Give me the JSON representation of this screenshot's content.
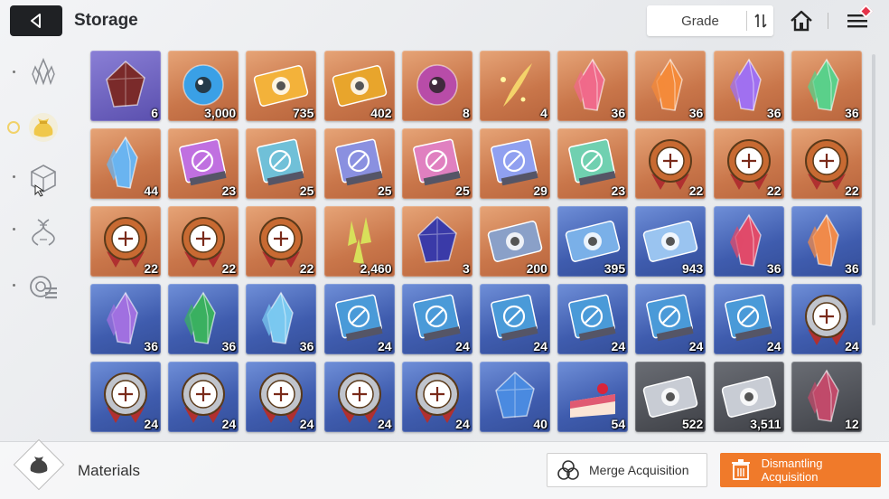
{
  "header": {
    "title": "Storage",
    "sort_label": "Grade"
  },
  "sidebar": {
    "categories": [
      {
        "icon": "crystal-cluster-icon",
        "active": false
      },
      {
        "icon": "pouch-icon",
        "active": true
      },
      {
        "icon": "cube-icon",
        "active": false
      },
      {
        "icon": "dna-helix-icon",
        "active": false
      },
      {
        "icon": "gear-list-icon",
        "active": false
      }
    ]
  },
  "items": [
    {
      "icon": "dark-stone-icon",
      "qty": "6",
      "rarity": "purple",
      "tint": "#7a2a2a"
    },
    {
      "icon": "blue-orb-creature-icon",
      "qty": "3,000",
      "rarity": "orange",
      "tint": "#3aa0e6"
    },
    {
      "icon": "gold-ticket-icon",
      "qty": "735",
      "rarity": "orange",
      "tint": "#f3b23a"
    },
    {
      "icon": "gold-compass-ticket-icon",
      "qty": "402",
      "rarity": "orange",
      "tint": "#e8a52c"
    },
    {
      "icon": "purple-eye-icon",
      "qty": "8",
      "rarity": "orange",
      "tint": "#b84ca8"
    },
    {
      "icon": "gold-feather-icon",
      "qty": "4",
      "rarity": "orange",
      "tint": "#f4d36a"
    },
    {
      "icon": "pink-crystal-icon",
      "qty": "36",
      "rarity": "orange",
      "tint": "#f06a8a"
    },
    {
      "icon": "orange-crystal-icon",
      "qty": "36",
      "rarity": "orange",
      "tint": "#f48a3a"
    },
    {
      "icon": "violet-crystal-icon",
      "qty": "36",
      "rarity": "orange",
      "tint": "#a070f0"
    },
    {
      "icon": "green-crystal-icon",
      "qty": "36",
      "rarity": "orange",
      "tint": "#5ad08a"
    },
    {
      "icon": "blue-crystal-icon",
      "qty": "44",
      "rarity": "orange",
      "tint": "#6ab4f0"
    },
    {
      "icon": "rainbow-book-sword-icon",
      "qty": "23",
      "rarity": "orange",
      "tint": "#c070e0"
    },
    {
      "icon": "rainbow-book-shield-icon",
      "qty": "25",
      "rarity": "orange",
      "tint": "#70c0d8"
    },
    {
      "icon": "rainbow-book-eye-icon",
      "qty": "25",
      "rarity": "orange",
      "tint": "#8a90e0"
    },
    {
      "icon": "rainbow-book-bird-icon",
      "qty": "25",
      "rarity": "orange",
      "tint": "#e080c0"
    },
    {
      "icon": "rainbow-book-bolt-icon",
      "qty": "29",
      "rarity": "orange",
      "tint": "#90a0f0"
    },
    {
      "icon": "rainbow-book-target-icon",
      "qty": "23",
      "rarity": "orange",
      "tint": "#70d0b0"
    },
    {
      "icon": "bronze-medal-cross-icon",
      "qty": "22",
      "rarity": "orange",
      "tint": "#c86a32"
    },
    {
      "icon": "bronze-medal-shield-icon",
      "qty": "22",
      "rarity": "orange",
      "tint": "#c86a32"
    },
    {
      "icon": "bronze-medal-frame-icon",
      "qty": "22",
      "rarity": "orange",
      "tint": "#c86a32"
    },
    {
      "icon": "bronze-medal-sword-icon",
      "qty": "22",
      "rarity": "orange",
      "tint": "#c86a32"
    },
    {
      "icon": "bronze-medal-bolt-icon",
      "qty": "22",
      "rarity": "orange",
      "tint": "#c86a32"
    },
    {
      "icon": "bronze-medal-target-icon",
      "qty": "22",
      "rarity": "orange",
      "tint": "#c86a32"
    },
    {
      "icon": "yellow-shards-icon",
      "qty": "2,460",
      "rarity": "orange",
      "tint": "#d8e05a"
    },
    {
      "icon": "dark-gem-icon",
      "qty": "3",
      "rarity": "orange",
      "tint": "#3a3aa8"
    },
    {
      "icon": "music-ticket-icon",
      "qty": "200",
      "rarity": "orange",
      "tint": "#8aa0c8"
    },
    {
      "icon": "blue-ticket-portrait-icon",
      "qty": "395",
      "rarity": "blue",
      "tint": "#7ab0e8"
    },
    {
      "icon": "blue-ticket-compass-icon",
      "qty": "943",
      "rarity": "blue",
      "tint": "#9ac4f0"
    },
    {
      "icon": "red-crystal-icon",
      "qty": "36",
      "rarity": "blue",
      "tint": "#e04a6a"
    },
    {
      "icon": "amber-crystal-icon",
      "qty": "36",
      "rarity": "blue",
      "tint": "#f08a4a"
    },
    {
      "icon": "purple-crystal-icon",
      "qty": "36",
      "rarity": "blue",
      "tint": "#a070e0"
    },
    {
      "icon": "emerald-crystal-icon",
      "qty": "36",
      "rarity": "blue",
      "tint": "#3ab060"
    },
    {
      "icon": "ice-crystal-icon",
      "qty": "36",
      "rarity": "blue",
      "tint": "#7ac8f0"
    },
    {
      "icon": "blue-book-sword-icon",
      "qty": "24",
      "rarity": "blue",
      "tint": "#4a9ad8"
    },
    {
      "icon": "blue-book-shield-icon",
      "qty": "24",
      "rarity": "blue",
      "tint": "#4a9ad8"
    },
    {
      "icon": "blue-book-eye-icon",
      "qty": "24",
      "rarity": "blue",
      "tint": "#4a9ad8"
    },
    {
      "icon": "blue-book-bird-icon",
      "qty": "24",
      "rarity": "blue",
      "tint": "#4a9ad8"
    },
    {
      "icon": "blue-book-bolt-icon",
      "qty": "24",
      "rarity": "blue",
      "tint": "#4a9ad8"
    },
    {
      "icon": "blue-book-target-icon",
      "qty": "24",
      "rarity": "blue",
      "tint": "#4a9ad8"
    },
    {
      "icon": "silver-medal-cross-icon",
      "qty": "24",
      "rarity": "blue",
      "tint": "#c0c4cc"
    },
    {
      "icon": "silver-medal-shield-icon",
      "qty": "24",
      "rarity": "blue",
      "tint": "#c0c4cc"
    },
    {
      "icon": "silver-medal-frame-icon",
      "qty": "24",
      "rarity": "blue",
      "tint": "#c0c4cc"
    },
    {
      "icon": "silver-medal-sword-icon",
      "qty": "24",
      "rarity": "blue",
      "tint": "#c0c4cc"
    },
    {
      "icon": "silver-medal-bolt-icon",
      "qty": "24",
      "rarity": "blue",
      "tint": "#c0c4cc"
    },
    {
      "icon": "silver-medal-target-icon",
      "qty": "24",
      "rarity": "blue",
      "tint": "#c0c4cc"
    },
    {
      "icon": "blue-spirit-gem-icon",
      "qty": "40",
      "rarity": "blue",
      "tint": "#4a8ae0"
    },
    {
      "icon": "strawberry-cake-icon",
      "qty": "54",
      "rarity": "blue",
      "tint": "#f08a9a"
    },
    {
      "icon": "gray-ticket-portrait-icon",
      "qty": "522",
      "rarity": "gray",
      "tint": "#c8ccd4"
    },
    {
      "icon": "gray-ticket-compass-icon",
      "qty": "3,511",
      "rarity": "gray",
      "tint": "#c8ccd4"
    },
    {
      "icon": "crimson-crystal-icon",
      "qty": "12",
      "rarity": "gray",
      "tint": "#c04a6a"
    }
  ],
  "footer": {
    "category_label": "Materials",
    "merge_label": "Merge Acquisition",
    "dismantle_label": "Dismantling Acquisition"
  },
  "colors": {
    "accent_orange": "#f07a2a",
    "dark_button": "#1f2124"
  }
}
